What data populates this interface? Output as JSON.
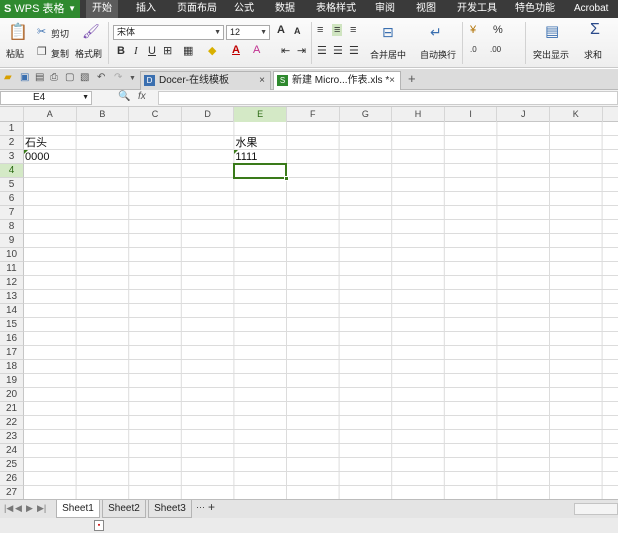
{
  "app": {
    "logo": "S",
    "name": "WPS 表格"
  },
  "menu": [
    "开始",
    "插入",
    "页面布局",
    "公式",
    "数据",
    "表格样式",
    "审阅",
    "视图",
    "开发工具",
    "特色功能",
    "Acrobat"
  ],
  "ribbon": {
    "paste": "粘贴",
    "cut": "剪切",
    "copy": "复制",
    "format_painter": "格式刷",
    "font_name": "宋体",
    "font_size": "12",
    "bold": "B",
    "italic": "I",
    "underline": "U",
    "grow_font": "A",
    "shrink_font": "A",
    "font_color_a": "A",
    "merge_center": "合并居中",
    "wrap_text": "自动换行",
    "percent": "%",
    "highlight": "突出显示",
    "sum": "求和",
    "sigma": "Σ",
    "currency": "¥"
  },
  "doc_tabs": [
    {
      "label": "Docer-在线模板",
      "close": "×"
    },
    {
      "label": "新建 Micro...作表.xls *",
      "close": "×"
    }
  ],
  "new_tab": "+",
  "formula_bar": {
    "name_box": "E4",
    "fx": "fx",
    "value": ""
  },
  "columns": [
    "A",
    "B",
    "C",
    "D",
    "E",
    "F",
    "G",
    "H",
    "I",
    "J",
    "K"
  ],
  "selected_column": "E",
  "rows": [
    "1",
    "2",
    "3",
    "4",
    "5",
    "6",
    "7",
    "8",
    "9",
    "10",
    "11",
    "12",
    "13",
    "14",
    "15",
    "16",
    "17",
    "18",
    "19",
    "20",
    "21",
    "22",
    "23",
    "24",
    "25",
    "26",
    "27"
  ],
  "selected_row": "4",
  "cells": {
    "A2": "石头",
    "A3": "0000",
    "E2": "水果",
    "E3": "1111"
  },
  "sheets": [
    "Sheet1",
    "Sheet2",
    "Sheet3"
  ],
  "active_sheet": "Sheet1",
  "sheet_more": "···",
  "sheet_add": "+",
  "colors": {
    "brand_green": "#2f8a2f",
    "selection": "#3a7a1a",
    "header_selected": "#d4e9c6"
  }
}
